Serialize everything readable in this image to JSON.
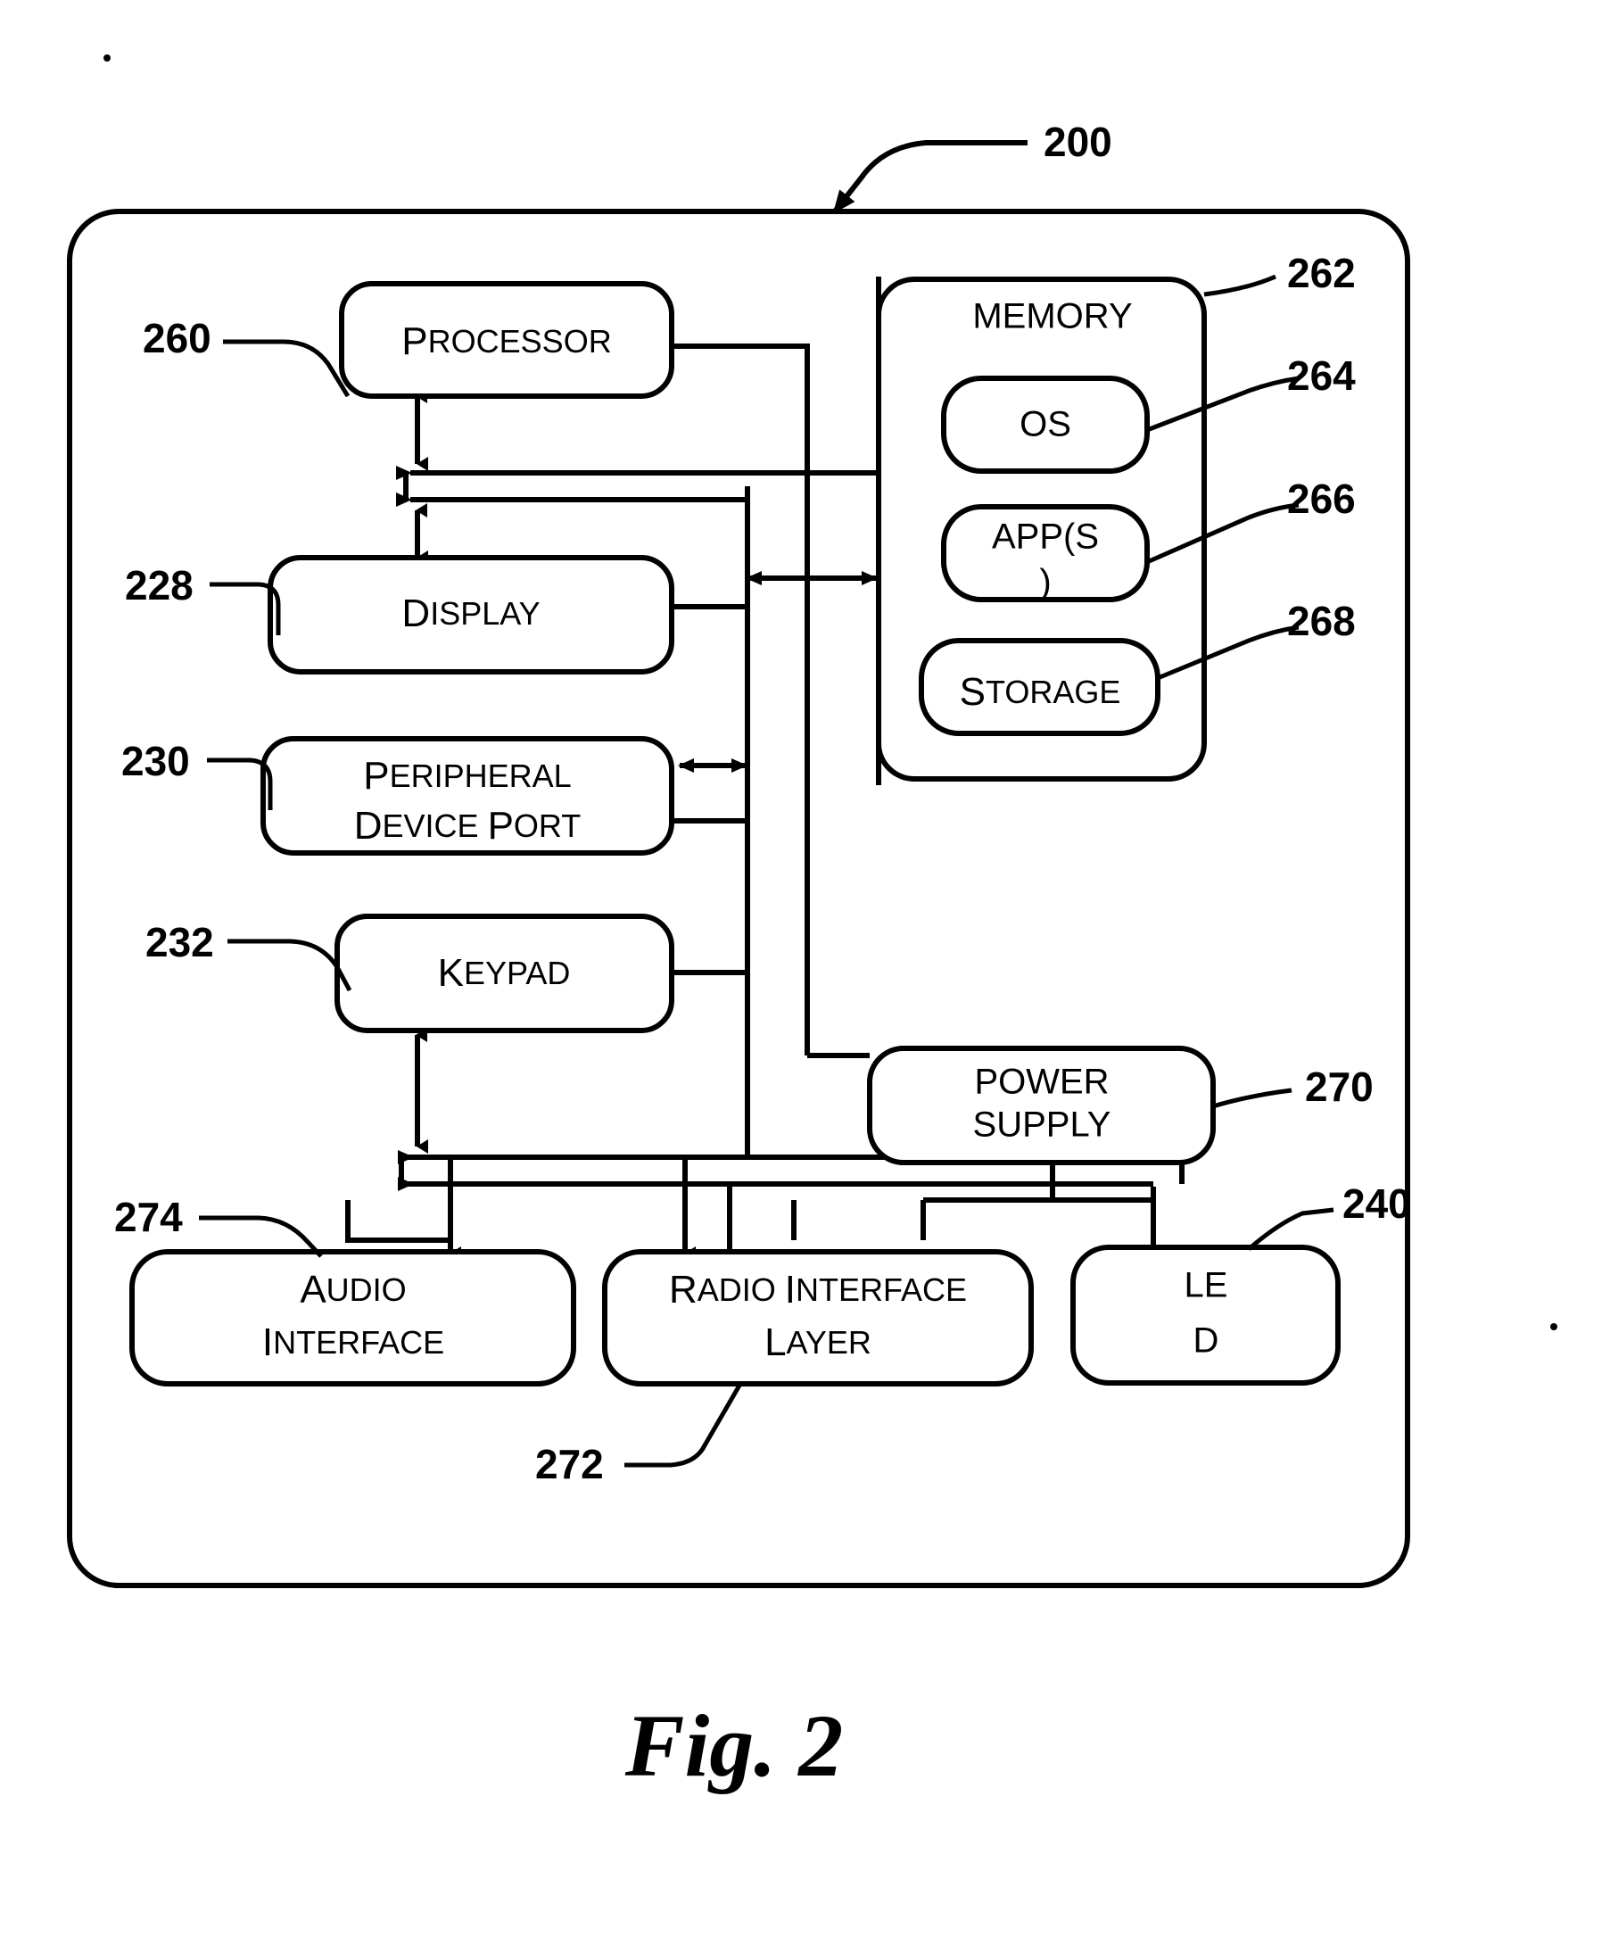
{
  "figure": {
    "caption": "Fig. 2",
    "device_ref": "200"
  },
  "blocks": {
    "processor": {
      "line1": "P",
      "line1_rest": "ROCESSOR",
      "ref": "260"
    },
    "display": {
      "line1": "D",
      "line1_rest": "ISPLAY",
      "ref": "228"
    },
    "peripheral_port": {
      "line1": "P",
      "line1_rest": "ERIPHERAL",
      "line2": "D",
      "line2_rest": "EVICE ",
      "line2_b": "P",
      "line2_b_rest": "ORT",
      "ref": "230"
    },
    "keypad": {
      "line1": "K",
      "line1_rest": "EYPAD",
      "ref": "232"
    },
    "memory": {
      "label": "MEMORY",
      "ref": "262"
    },
    "os": {
      "label": "OS",
      "ref": "264"
    },
    "apps": {
      "line1": "APP(S",
      "line2": ")",
      "ref": "266"
    },
    "storage": {
      "line1": "S",
      "line1_rest": "TORAGE",
      "ref": "268"
    },
    "power_supply": {
      "line1": "POWER",
      "line2": "SUPPLY",
      "ref": "270"
    },
    "audio_interface": {
      "line1": "A",
      "line1_rest": "UDIO",
      "line2": "I",
      "line2_rest": "NTERFACE",
      "ref": "274"
    },
    "radio_interface": {
      "line1": "R",
      "line1_rest": "ADIO ",
      "line1_b": "I",
      "line1_b_rest": "NTERFACE",
      "line2": "L",
      "line2_rest": "AYER",
      "ref": "272"
    },
    "led": {
      "line1": "LE",
      "line2": "D",
      "ref": "240"
    }
  },
  "colors": {
    "stroke": "#000000",
    "background": "#ffffff"
  }
}
